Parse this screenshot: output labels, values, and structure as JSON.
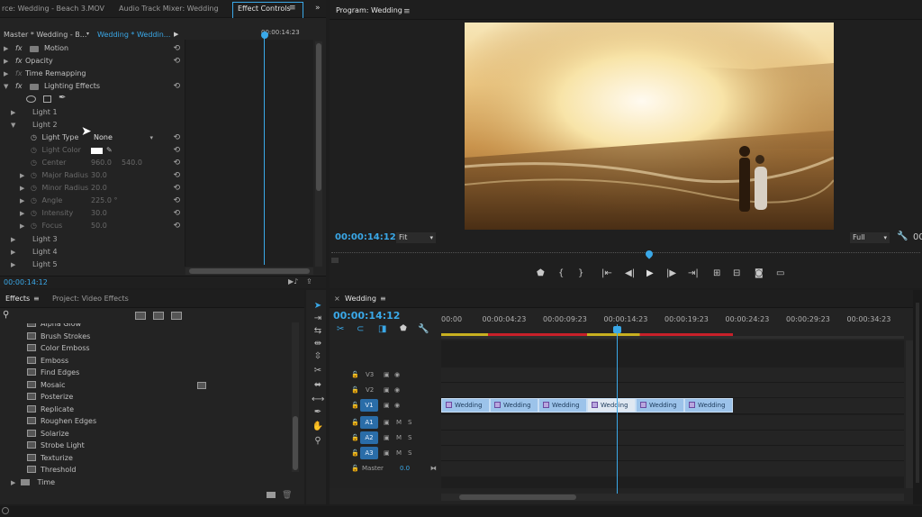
{
  "effect_controls_panel": {
    "tabs": [
      "rce: Wedding - Beach 3.MOV",
      "Audio Track Mixer: Wedding",
      "Effect Controls"
    ],
    "source_label": "Master * Wedding - B...",
    "clip_label": "Wedding * Weddin...",
    "timecode_top": "00:00:14:23",
    "effects": [
      {
        "label": "Motion"
      },
      {
        "label": "Opacity"
      },
      {
        "label": "Time Remapping"
      },
      {
        "label": "Lighting Effects"
      }
    ],
    "lights": [
      "Light 1",
      "Light 2",
      "Light 3",
      "Light 4",
      "Light 5"
    ],
    "light_type_label": "Light Type",
    "light_type_value": "None",
    "params": [
      {
        "label": "Light Color",
        "value": ""
      },
      {
        "label": "Center",
        "value": "960.0",
        "value2": "540.0"
      },
      {
        "label": "Major Radius",
        "value": "30.0"
      },
      {
        "label": "Minor Radius",
        "value": "20.0"
      },
      {
        "label": "Angle",
        "value": "225.0 °"
      },
      {
        "label": "Intensity",
        "value": "30.0"
      },
      {
        "label": "Focus",
        "value": "50.0"
      }
    ],
    "timecode_bottom": "00:00:14:12"
  },
  "program_monitor": {
    "title": "Program: Wedding",
    "timecode": "00:00:14:12",
    "fit": "Fit",
    "quality": "Full",
    "timecode_right": "00",
    "playhead_fraction": 0.54
  },
  "effects_panel": {
    "tabs": [
      "Effects",
      "Project: Video Effects"
    ],
    "items": [
      "Alpha Glow",
      "Brush Strokes",
      "Color Emboss",
      "Emboss",
      "Find Edges",
      "Mosaic",
      "Posterize",
      "Replicate",
      "Roughen Edges",
      "Solarize",
      "Strobe Light",
      "Texturize",
      "Threshold"
    ],
    "folder": "Time"
  },
  "timeline": {
    "title": "Wedding",
    "timecode": "00:00:14:12",
    "ruler": [
      "00:00",
      "00:00:04:23",
      "00:00:09:23",
      "00:00:14:23",
      "00:00:19:23",
      "00:00:24:23",
      "00:00:29:23",
      "00:00:34:23"
    ],
    "video_tracks": [
      "V3",
      "V2",
      "V1"
    ],
    "audio_tracks": [
      "A1",
      "A2",
      "A3"
    ],
    "master_label": "Master",
    "master_value": "0.0",
    "mute": "M",
    "solo": "S",
    "clips": [
      "Wedding",
      "Wedding",
      "Wedding",
      "Wedding",
      "Wedding",
      "Wedding"
    ]
  },
  "colors": {
    "accent": "#3aa8e8",
    "clip": "#9cc3ea",
    "work_area_red": "#c8202a",
    "work_area_yellow": "#d0c020"
  }
}
